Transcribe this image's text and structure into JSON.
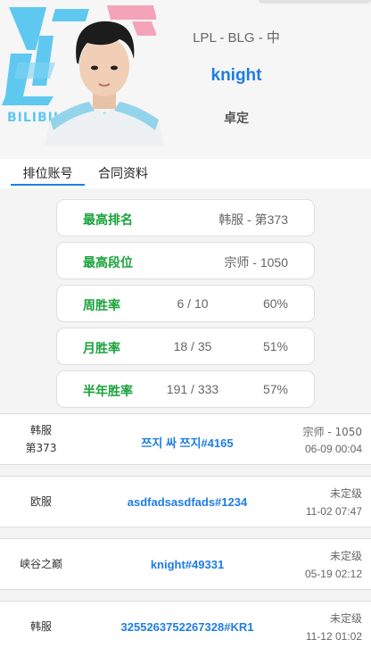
{
  "header": {
    "region": "LPL - BLG - 中",
    "player_name": "knight",
    "real_name": "卓定"
  },
  "tabs": [
    {
      "label": "排位账号",
      "active": true
    },
    {
      "label": "合同资料",
      "active": false
    }
  ],
  "stats": {
    "highest_rank": {
      "label": "最高排名",
      "value": "韩服 - 第373"
    },
    "highest_tier": {
      "label": "最高段位",
      "value": "宗师 - 1050"
    },
    "weekly": {
      "label": "周胜率",
      "count": "6 / 10",
      "pct": "60%"
    },
    "monthly": {
      "label": "月胜率",
      "count": "18 / 35",
      "pct": "51%"
    },
    "half_year": {
      "label": "半年胜率",
      "count": "191 / 333",
      "pct": "57%"
    }
  },
  "accounts": [
    {
      "server_line1": "韩服",
      "server_line2": "第373",
      "name": "쯔지 싸 쯔지#4165",
      "rank": "宗师 - 1050",
      "time": "06-09 00:04"
    },
    {
      "server_line1": "欧服",
      "server_line2": "",
      "name": "asdfadsasdfads#1234",
      "rank": "未定级",
      "time": "11-02 07:47"
    },
    {
      "server_line1": "峡谷之巅",
      "server_line2": "",
      "name": "knight#49331",
      "rank": "未定级",
      "time": "05-19 02:12"
    },
    {
      "server_line1": "韩服",
      "server_line2": "",
      "name": "3255263752267328#KR1",
      "rank": "未定级",
      "time": "11-12 01:02"
    }
  ],
  "colors": {
    "accent": "#1e7de3",
    "label_green": "#19a33a",
    "logo_blue": "#5fc8f0",
    "logo_pink": "#f4a4b8"
  },
  "icons": {
    "team_logo": "blg-logo",
    "player_photo": "player-avatar"
  }
}
